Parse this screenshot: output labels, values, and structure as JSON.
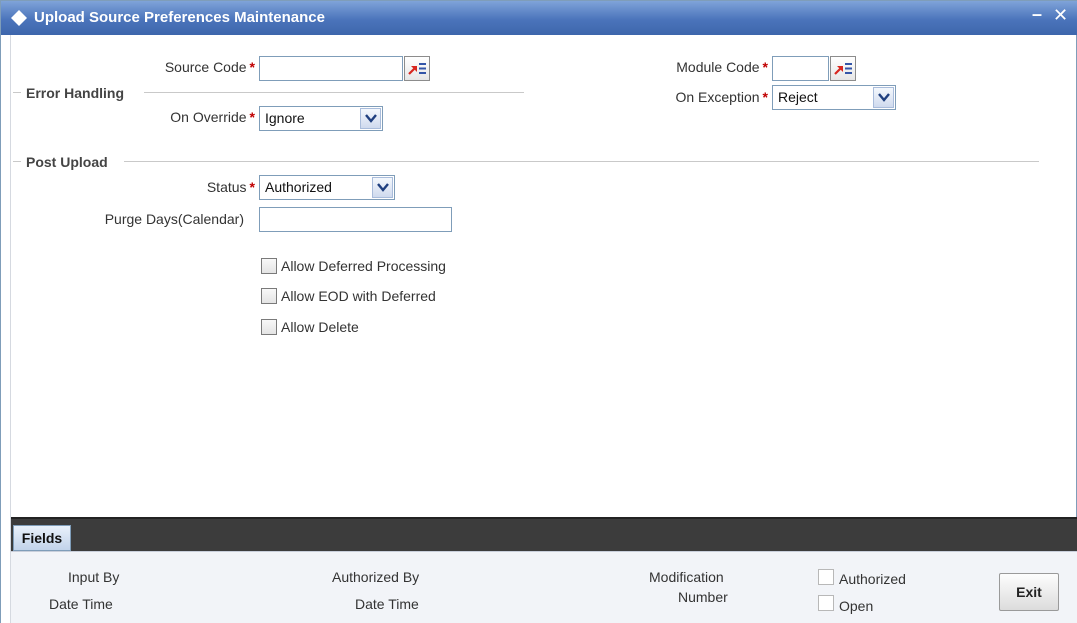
{
  "window": {
    "title": "Upload Source Preferences Maintenance",
    "minimize_symbol": "–",
    "close_symbol": "✕"
  },
  "form": {
    "source_code": {
      "label": "Source Code",
      "required": "*",
      "value": ""
    },
    "module_code": {
      "label": "Module Code",
      "required": "*",
      "value": ""
    },
    "error_handling": {
      "section": "Error Handling",
      "on_override": {
        "label": "On Override",
        "required": "*",
        "value": "Ignore"
      },
      "on_exception": {
        "label": "On Exception",
        "required": "*",
        "value": "Reject"
      }
    },
    "post_upload": {
      "section": "Post Upload",
      "status": {
        "label": "Status",
        "required": "*",
        "value": "Authorized"
      },
      "purge_days": {
        "label": "Purge Days(Calendar)",
        "value": ""
      }
    },
    "checkboxes": [
      {
        "label": "Allow Deferred Processing",
        "checked": false
      },
      {
        "label": "Allow EOD with Deferred",
        "checked": false
      },
      {
        "label": "Allow Delete",
        "checked": false
      }
    ]
  },
  "bottom": {
    "fields_button": "Fields",
    "input_by": "Input By",
    "date_time_1": "Date Time",
    "authorized_by": "Authorized By",
    "date_time_2": "Date Time",
    "modification": "Modification",
    "number": "Number",
    "authorized_check": "Authorized",
    "open_check": "Open",
    "exit_button": "Exit"
  },
  "colors": {
    "titlebar": "#4b74bb",
    "required": "#c00000",
    "lov_arrow": "#d8261f",
    "lov_lines": "#3355a8"
  },
  "icons": {
    "title": "diamond-icon",
    "lov": "list-of-values-icon",
    "dropdown": "chevron-down-icon"
  }
}
